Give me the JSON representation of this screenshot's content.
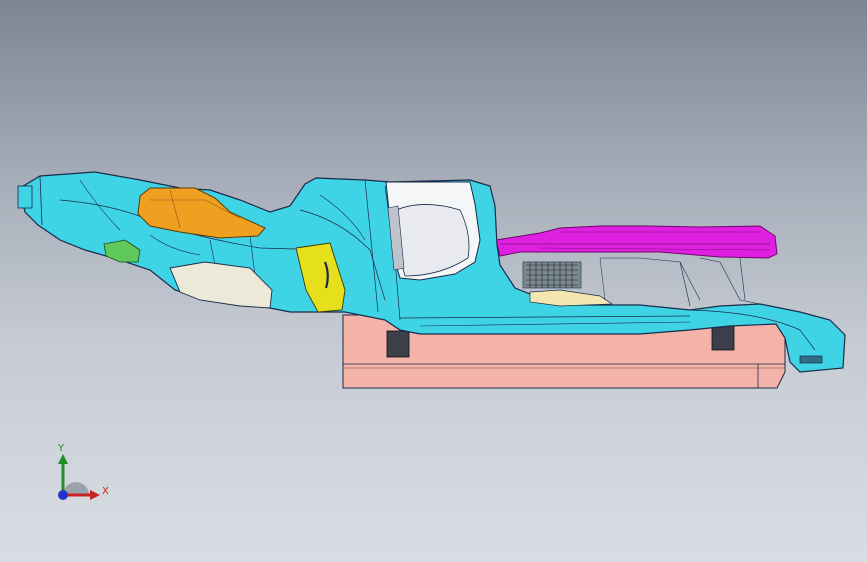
{
  "viewport": {
    "background_top": "#7d8594",
    "background_bottom": "#d9dde3"
  },
  "model": {
    "colors": {
      "body": "#3fd3e6",
      "orange_part": "#f0a020",
      "yellow_part": "#e6e01c",
      "magenta_part": "#e020e0",
      "base_block": "#f4b3a8",
      "beige_part": "#ece9d8",
      "green_part": "#5ec85a",
      "edge": "#1a2a4a"
    }
  },
  "triad": {
    "x_label": "X",
    "y_label": "Y",
    "x_color": "#c92222",
    "y_color": "#1f8f2a",
    "z_color": "#2233cc"
  }
}
